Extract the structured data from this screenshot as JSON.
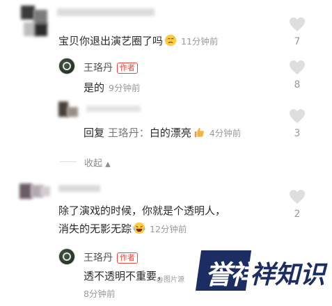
{
  "comments": [
    {
      "text": "宝贝你退出演艺圈了吗",
      "time": "11分钟前",
      "likes": "7",
      "emoji_icon": "sweating-face-icon",
      "replies": [
        {
          "author": "王珞丹",
          "tag": "作者",
          "text": "是的",
          "time": "9分钟前",
          "likes": "8"
        },
        {
          "prefix": "回复",
          "reply_to": "王珞丹：",
          "text": "白的漂亮",
          "emoji_icon": "thumbs-up-icon",
          "time": "4分钟前",
          "likes": "3"
        }
      ],
      "collapse_label": "收起"
    },
    {
      "text_line1": "除了演戏的时候，你就是个透明人，",
      "text_line2": "消失的无影无踪",
      "emoji_icon": "laughing-face-icon",
      "time": "12分钟前",
      "likes": "2",
      "replies": [
        {
          "author": "王珞丹",
          "tag": "作者",
          "text": "透不透明不重要，",
          "time": "8分钟前"
        }
      ]
    }
  ],
  "watermark": {
    "badge_text": "誉祥",
    "text": "祥知识",
    "source": "@图片源"
  },
  "colors": {
    "tag": "#e8483c",
    "watermark": "#1c2d63",
    "muted": "#9a9a9a"
  }
}
